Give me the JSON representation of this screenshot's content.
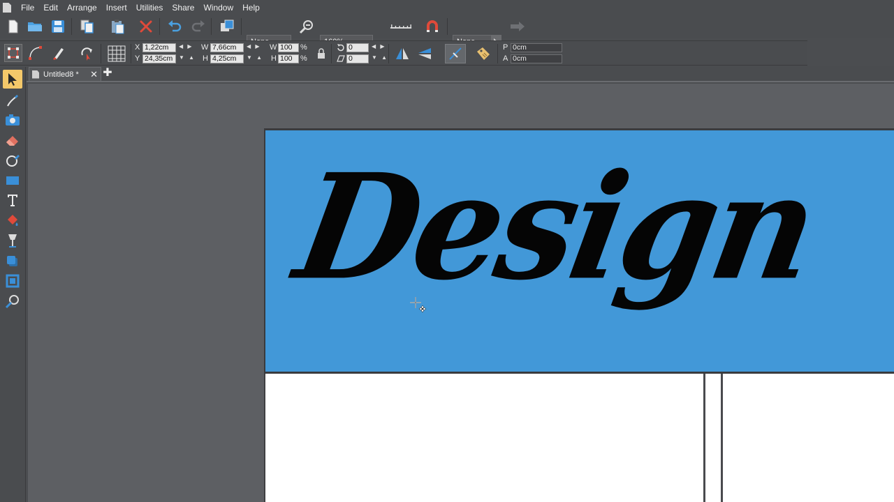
{
  "menu": {
    "items": [
      {
        "label": "File"
      },
      {
        "label": "Edit"
      },
      {
        "label": "Arrange"
      },
      {
        "label": "Insert"
      },
      {
        "label": "Utilities"
      },
      {
        "label": "Share"
      },
      {
        "label": "Window"
      },
      {
        "label": "Help"
      }
    ]
  },
  "toolbar": {
    "shadow_combo": "None",
    "zoom_combo": "160%",
    "transparency_combo": "None"
  },
  "status": {
    "x_label": "X",
    "x_value": "1,22cm",
    "y_label": "Y",
    "y_value": "24,35cm",
    "w_label": "W",
    "w_value": "7,66cm",
    "h_label": "H",
    "h_value": "4,25cm",
    "sw_label": "W",
    "sw_value": "100",
    "sh_label": "H",
    "sh_value": "100",
    "percent": "%",
    "rot_value": "0",
    "skew_value": "0",
    "p_label": "P",
    "p_value": "0cm",
    "a_label": "A",
    "a_value": "0cm"
  },
  "tabs": {
    "document_tab": "Untitled8 *",
    "close_glyph": "✕",
    "add_glyph": "✚"
  },
  "canvas": {
    "banner_text": "Design",
    "banner_color": "#4298d8"
  },
  "colors": {
    "ui_bg": "#4a4c4f",
    "workspace_bg": "#5d5f63",
    "active_tool": "#f4c86a",
    "delete_red": "#e04a3a",
    "accent_blue": "#3a8fd8"
  }
}
